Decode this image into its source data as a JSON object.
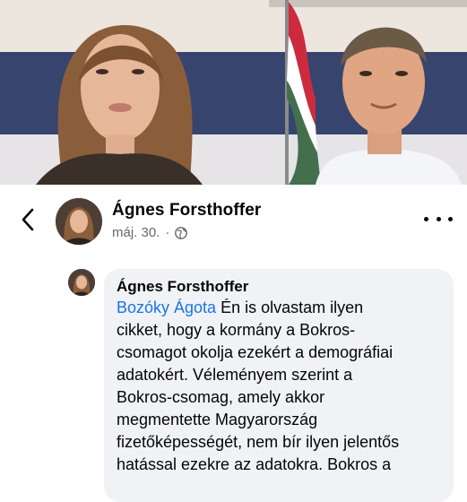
{
  "post": {
    "author": "Ágnes Forsthoffer",
    "date": "máj. 30.",
    "separator": "·",
    "privacy_icon": "globe-icon",
    "back_icon": "chevron-left-icon",
    "more_icon": "more-horizontal-icon"
  },
  "comment": {
    "author": "Ágnes Forsthoffer",
    "mention": "Bozóky Ágota",
    "text": " Én is olvastam ilyen\ncikket, hogy a kormány a Bokros-\ncsomagot okolja ezekért a demográfiai\nadatokért. Véleményem szerint a\nBokros-csomag, amely akkor\nmegmentette Magyarország\nfizetőképességét, nem bír ilyen jelentős\nhatással ezekre az adatokra. Bokros a"
  },
  "colors": {
    "mention": "#1b74e4",
    "bubble": "#f0f2f5",
    "meta": "#65676b",
    "flag_red": "#cd2a3e",
    "flag_white": "#ffffff",
    "flag_green": "#436f4d"
  }
}
